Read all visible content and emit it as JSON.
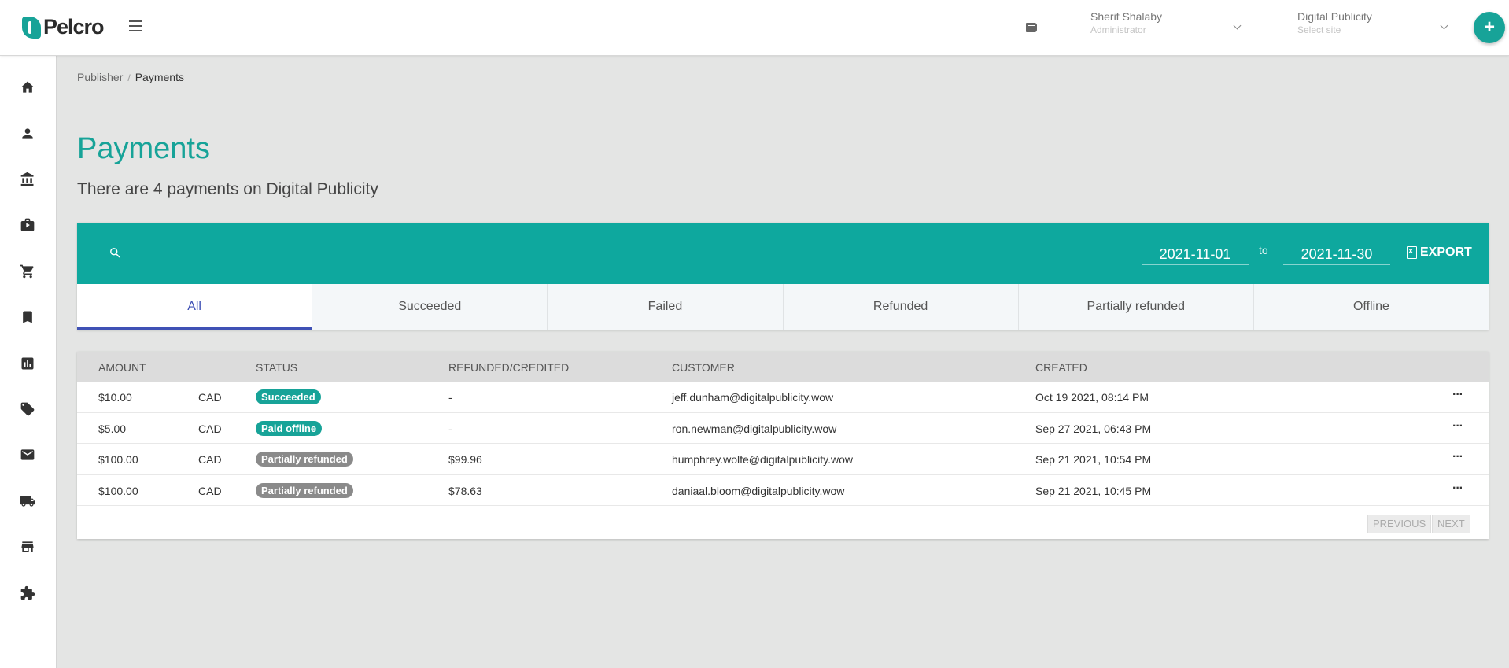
{
  "header": {
    "logo_text": "Pelcro",
    "user": {
      "name": "Sherif Shalaby",
      "role": "Administrator"
    },
    "site": {
      "name": "Digital Publicity",
      "placeholder": "Select site"
    },
    "add_button": "+"
  },
  "sidebar": {
    "items": [
      "home-icon",
      "user-icon",
      "bank-icon",
      "briefcase-icon",
      "cart-icon",
      "bookmark-icon",
      "chart-icon",
      "ticket-icon",
      "mail-icon",
      "truck-icon",
      "store-icon",
      "puzzle-icon"
    ]
  },
  "breadcrumb": {
    "parent": "Publisher",
    "separator": "/",
    "current": "Payments"
  },
  "page": {
    "title": "Payments",
    "subtitle": "There are 4 payments on Digital Publicity"
  },
  "filters": {
    "date_from": "2021-11-01",
    "to_label": "to",
    "date_to": "2021-11-30",
    "export_label": "EXPORT"
  },
  "tabs": [
    "All",
    "Succeeded",
    "Failed",
    "Refunded",
    "Partially refunded",
    "Offline"
  ],
  "table": {
    "headers": {
      "amount": "AMOUNT",
      "status": "STATUS",
      "refunded": "REFUNDED/CREDITED",
      "customer": "CUSTOMER",
      "created": "CREATED"
    },
    "rows": [
      {
        "amount": "$10.00",
        "currency": "CAD",
        "status": "Succeeded",
        "refunded": "-",
        "customer": "jeff.dunham@digitalpublicity.wow",
        "created": "Oct 19 2021, 08:14 PM",
        "menu": "···"
      },
      {
        "amount": "$5.00",
        "currency": "CAD",
        "status": "Paid offline",
        "refunded": "-",
        "customer": "ron.newman@digitalpublicity.wow",
        "created": "Sep 27 2021, 06:43 PM",
        "menu": "···"
      },
      {
        "amount": "$100.00",
        "currency": "CAD",
        "status": "Partially refunded",
        "refunded": "$99.96",
        "customer": "humphrey.wolfe@digitalpublicity.wow",
        "created": "Sep 21 2021, 10:54 PM",
        "menu": "···"
      },
      {
        "amount": "$100.00",
        "currency": "CAD",
        "status": "Partially refunded",
        "refunded": "$78.63",
        "customer": "daniaal.bloom@digitalpublicity.wow",
        "created": "Sep 21 2021, 10:45 PM",
        "menu": "···"
      }
    ],
    "pagination": {
      "previous": "PREVIOUS",
      "next": "NEXT"
    }
  },
  "colors": {
    "accent": "#17a398",
    "filter_bar": "#0ea89e",
    "active_tab": "#3f51b5",
    "badge_grey": "#8a8a8a"
  }
}
